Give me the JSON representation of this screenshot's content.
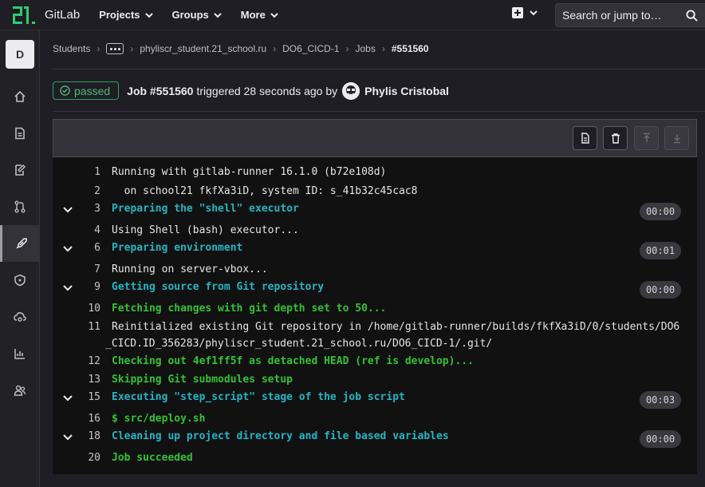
{
  "topbar": {
    "brand": "GitLab",
    "nav": [
      {
        "label": "Projects"
      },
      {
        "label": "Groups"
      },
      {
        "label": "More"
      }
    ],
    "search_placeholder": "Search or jump to…"
  },
  "sidebar": {
    "project_initial": "D",
    "items": [
      {
        "icon": "home-icon"
      },
      {
        "icon": "issues-icon"
      },
      {
        "icon": "edit-icon"
      },
      {
        "icon": "merge-request-icon"
      },
      {
        "icon": "rocket-icon",
        "active": true
      },
      {
        "icon": "shield-icon"
      },
      {
        "icon": "cloud-gear-icon"
      },
      {
        "icon": "analytics-icon"
      },
      {
        "icon": "users-icon"
      }
    ]
  },
  "breadcrumb": {
    "items": [
      "Students",
      "phyliscr_student.21_school.ru",
      "DO6_CICD-1",
      "Jobs"
    ],
    "current": "#551560"
  },
  "job": {
    "status": "passed",
    "title": "Job #551560",
    "subtitle": "triggered 28 seconds ago by",
    "author": "Phylis Cristobal",
    "status_color": "#2da160"
  },
  "log": {
    "lines": [
      {
        "n": "1",
        "text": "Running with gitlab-runner 16.1.0 (b72e108d)",
        "style": ""
      },
      {
        "n": "2",
        "text": "  on school21 fkfXa3iD, system ID: s_41b32c45cac8",
        "style": ""
      },
      {
        "n": "3",
        "text": "Preparing the \"shell\" executor",
        "style": "cyan",
        "section": true,
        "duration": "00:00"
      },
      {
        "n": "4",
        "text": "Using Shell (bash) executor...",
        "style": ""
      },
      {
        "n": "6",
        "text": "Preparing environment",
        "style": "cyan",
        "section": true,
        "duration": "00:01"
      },
      {
        "n": "7",
        "text": "Running on server-vbox...",
        "style": ""
      },
      {
        "n": "9",
        "text": "Getting source from Git repository",
        "style": "cyan",
        "section": true,
        "duration": "00:00"
      },
      {
        "n": "10",
        "text": "Fetching changes with git depth set to 50...",
        "style": "green"
      },
      {
        "n": "11",
        "text": "Reinitialized existing Git repository in /home/gitlab-runner/builds/fkfXa3iD/0/students/DO6",
        "style": ""
      },
      {
        "n": "",
        "text": "_CICD.ID_356283/phyliscr_student.21_school.ru/DO6_CICD-1/.git/",
        "style": ""
      },
      {
        "n": "12",
        "text": "Checking out 4ef1ff5f as detached HEAD (ref is develop)...",
        "style": "green"
      },
      {
        "n": "13",
        "text": "Skipping Git submodules setup",
        "style": "green"
      },
      {
        "n": "15",
        "text": "Executing \"step_script\" stage of the job script",
        "style": "cyan",
        "section": true,
        "duration": "00:03"
      },
      {
        "n": "16",
        "text": "$ src/deploy.sh",
        "style": "green"
      },
      {
        "n": "18",
        "text": "Cleaning up project directory and file based variables",
        "style": "cyan",
        "section": true,
        "duration": "00:00"
      },
      {
        "n": "20",
        "text": "Job succeeded",
        "style": "green"
      }
    ]
  }
}
